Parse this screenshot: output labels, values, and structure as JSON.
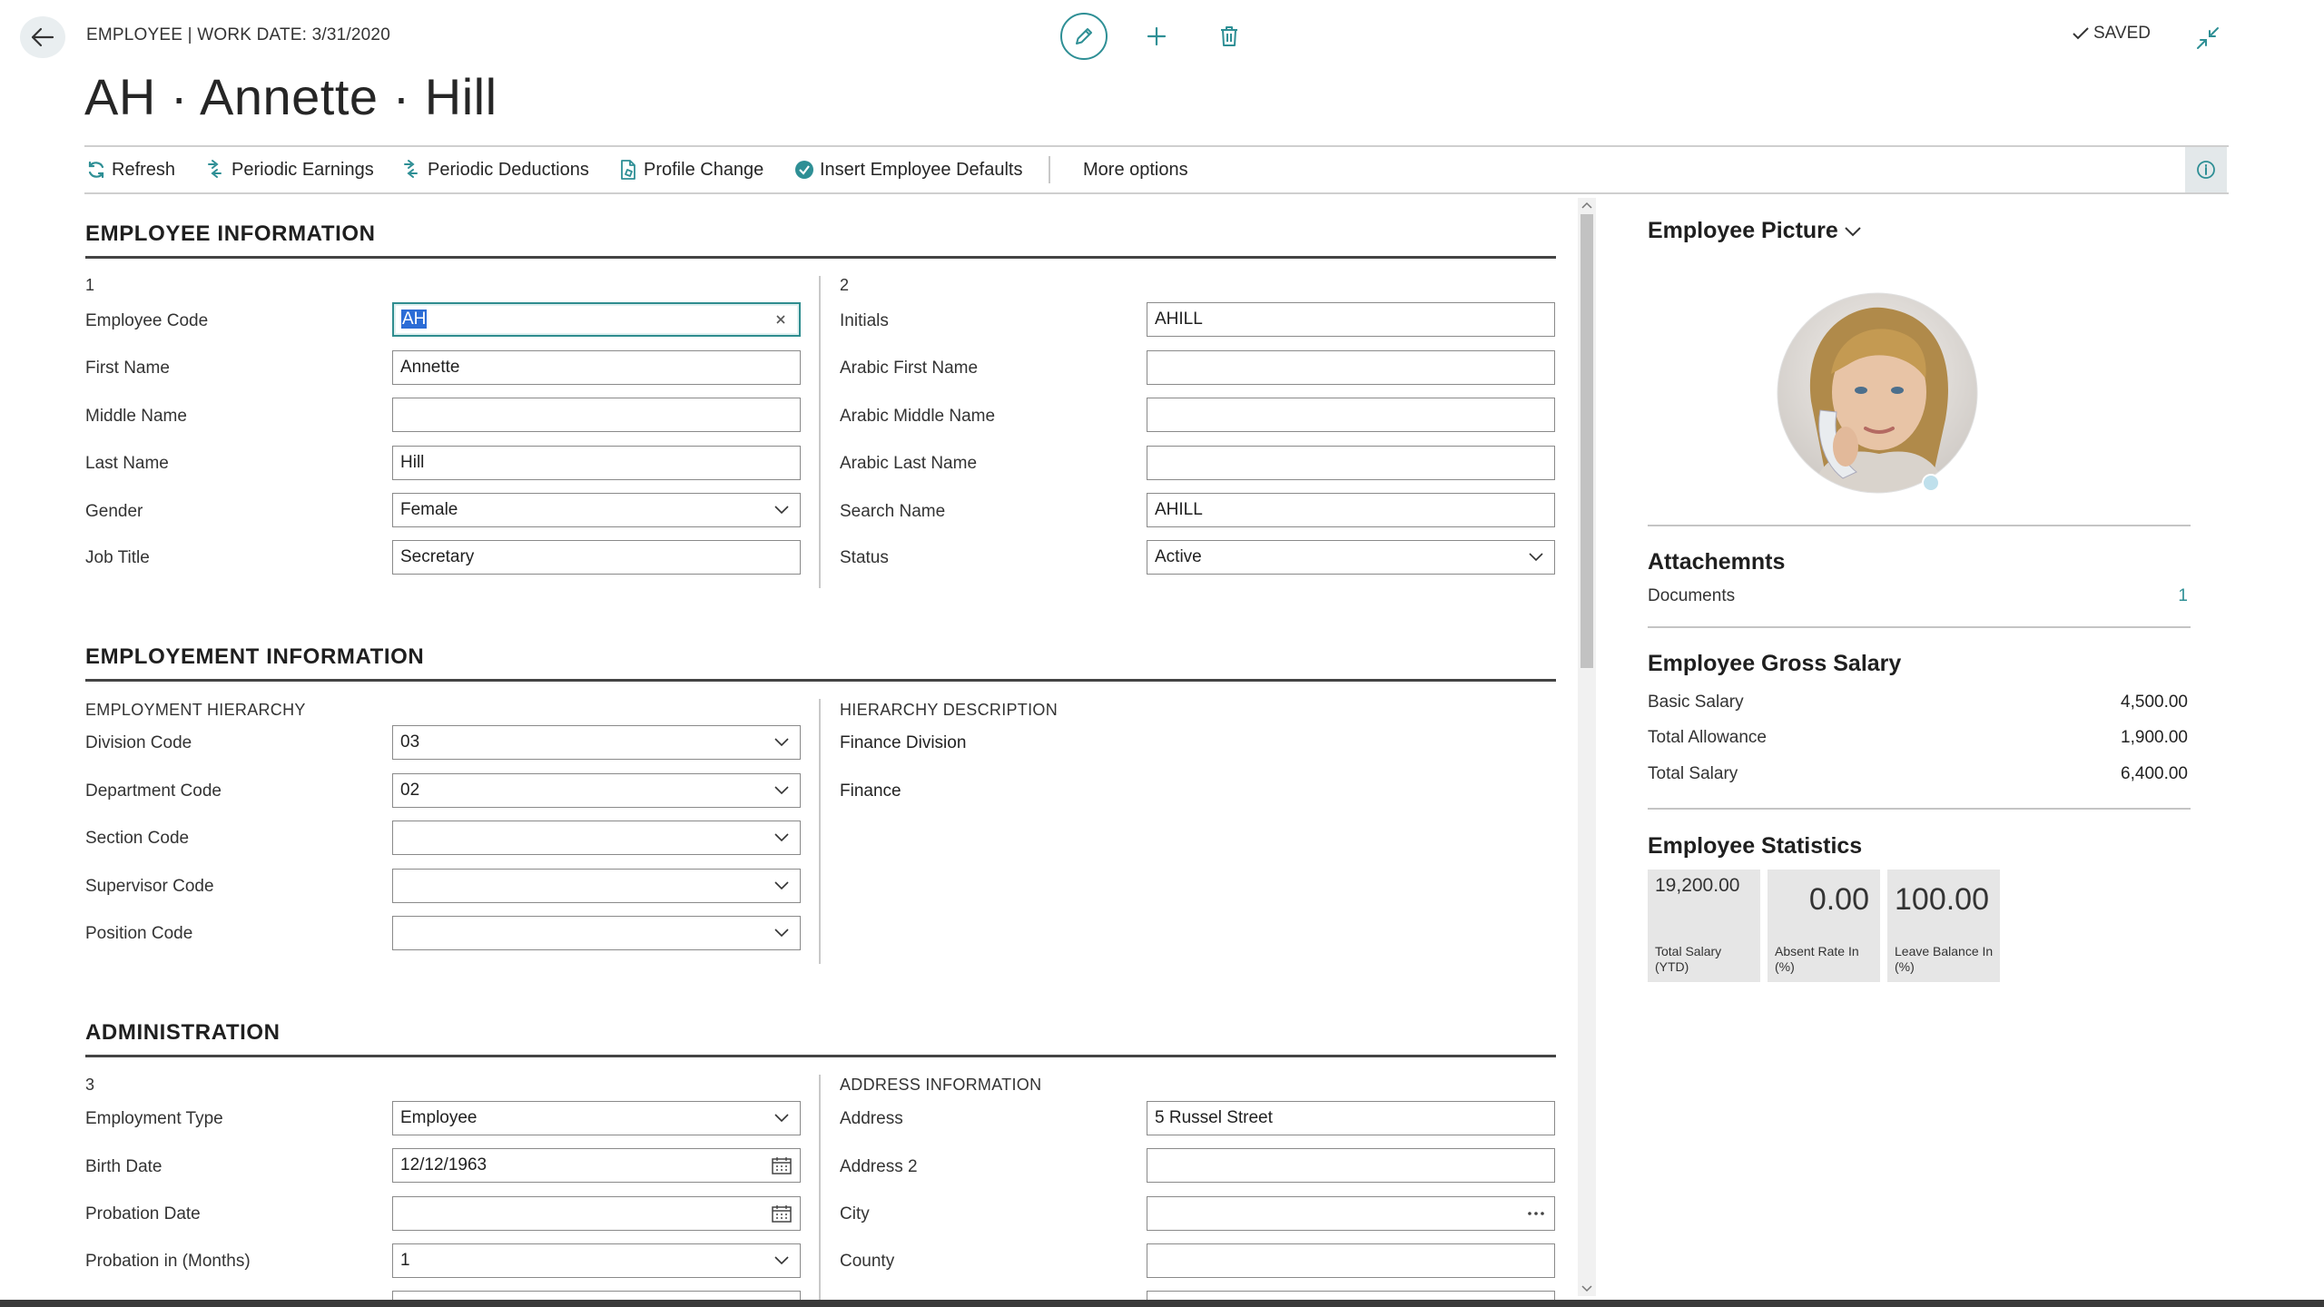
{
  "header": {
    "breadcrumb": "EMPLOYEE | WORK DATE: 3/31/2020",
    "title": "AH · Annette · Hill",
    "saved": "SAVED"
  },
  "actions": {
    "refresh": "Refresh",
    "periodic_earnings": "Periodic Earnings",
    "periodic_deductions": "Periodic Deductions",
    "profile_change": "Profile Change",
    "insert_defaults": "Insert Employee Defaults",
    "more_options": "More options"
  },
  "employee_info": {
    "title": "EMPLOYEE INFORMATION",
    "col1_head": "1",
    "col2_head": "2",
    "employee_code": {
      "label": "Employee Code",
      "value": "AH"
    },
    "first_name": {
      "label": "First Name",
      "value": "Annette"
    },
    "middle_name": {
      "label": "Middle Name",
      "value": ""
    },
    "last_name": {
      "label": "Last Name",
      "value": "Hill"
    },
    "gender": {
      "label": "Gender",
      "value": "Female"
    },
    "job_title": {
      "label": "Job Title",
      "value": "Secretary"
    },
    "initials": {
      "label": "Initials",
      "value": "AHILL"
    },
    "arabic_first_name": {
      "label": "Arabic First Name",
      "value": ""
    },
    "arabic_middle_name": {
      "label": "Arabic Middle Name",
      "value": ""
    },
    "arabic_last_name": {
      "label": "Arabic Last Name",
      "value": ""
    },
    "search_name": {
      "label": "Search Name",
      "value": "AHILL"
    },
    "status": {
      "label": "Status",
      "value": "Active"
    }
  },
  "employment_info": {
    "title": "EMPLOYEMENT INFORMATION",
    "hierarchy_head": "EMPLOYMENT HIERARCHY",
    "description_head": "HIERARCHY DESCRIPTION",
    "division_code": {
      "label": "Division Code",
      "value": "03"
    },
    "department_code": {
      "label": "Department Code",
      "value": "02"
    },
    "section_code": {
      "label": "Section Code",
      "value": ""
    },
    "supervisor_code": {
      "label": "Supervisor Code",
      "value": ""
    },
    "position_code": {
      "label": "Position Code",
      "value": ""
    },
    "division_desc": "Finance Division",
    "department_desc": "Finance"
  },
  "administration": {
    "title": "ADMINISTRATION",
    "col1_head": "3",
    "address_head": "ADDRESS INFORMATION",
    "employment_type": {
      "label": "Employment Type",
      "value": "Employee"
    },
    "birth_date": {
      "label": "Birth Date",
      "value": "12/12/1963"
    },
    "probation_date": {
      "label": "Probation Date",
      "value": ""
    },
    "probation_months": {
      "label": "Probation in (Months)",
      "value": "1"
    },
    "address": {
      "label": "Address",
      "value": "5 Russel Street"
    },
    "address2": {
      "label": "Address 2",
      "value": ""
    },
    "city": {
      "label": "City",
      "value": ""
    },
    "county": {
      "label": "County",
      "value": ""
    }
  },
  "factbox": {
    "picture_title": "Employee Picture",
    "attachments_title": "Attachemnts",
    "documents_label": "Documents",
    "documents_count": "1",
    "gross_title": "Employee Gross Salary",
    "basic_salary_label": "Basic Salary",
    "basic_salary": "4,500.00",
    "total_allowance_label": "Total Allowance",
    "total_allowance": "1,900.00",
    "total_salary_label": "Total Salary",
    "total_salary": "6,400.00",
    "stats_title": "Employee Statistics",
    "tiles": [
      {
        "value": "19,200.00",
        "label": "Total Salary (YTD)"
      },
      {
        "value": "0.00",
        "label": "Absent Rate In (%)"
      },
      {
        "value": "100.00",
        "label": "Leave Balance In (%)"
      }
    ]
  },
  "colors": {
    "accent": "#2e8f95",
    "selection": "#2b6cd6",
    "tile_bg": "#e6e6e6"
  }
}
